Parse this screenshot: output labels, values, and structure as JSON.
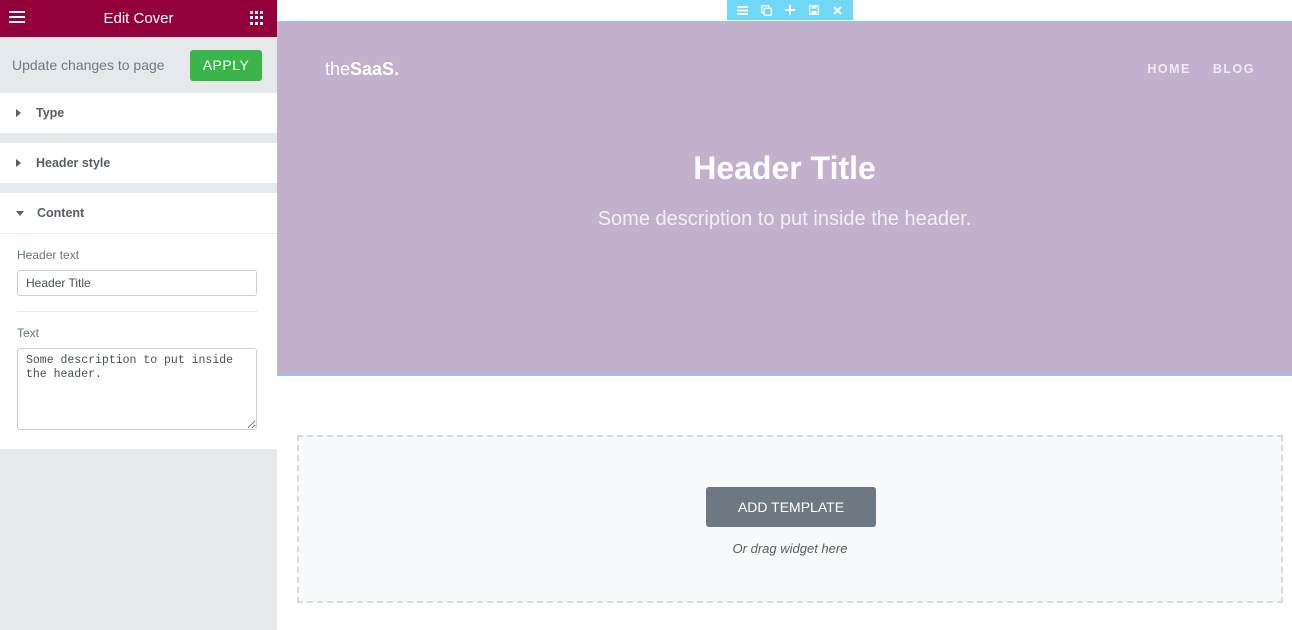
{
  "panel": {
    "title": "Edit Cover",
    "menu_icon": "hamburger-icon",
    "widgets_icon": "grid-icon",
    "apply_label_text": "Update changes to page",
    "apply_button": "APPLY",
    "sections": [
      {
        "label": "Type",
        "expanded": false
      },
      {
        "label": "Header style",
        "expanded": false
      },
      {
        "label": "Content",
        "expanded": true
      }
    ],
    "content": {
      "header_text_label": "Header text",
      "header_text_value": "Header Title",
      "text_label": "Text",
      "text_value": "Some description to put inside the header."
    }
  },
  "toolbar_icons": [
    "hamburger-icon",
    "duplicate-icon",
    "plus-icon",
    "save-icon",
    "close-icon"
  ],
  "preview": {
    "logo_light": "the",
    "logo_bold": "SaaS.",
    "nav": [
      "HOME",
      "BLOG"
    ],
    "title": "Header Title",
    "description": "Some description to put inside the header."
  },
  "dropzone": {
    "button": "ADD TEMPLATE",
    "hint": "Or drag widget here"
  },
  "colors": {
    "accent": "#93003c",
    "apply": "#39b54a",
    "header_bg": "#c2b0cd",
    "toolbar": "#71d7f7"
  }
}
